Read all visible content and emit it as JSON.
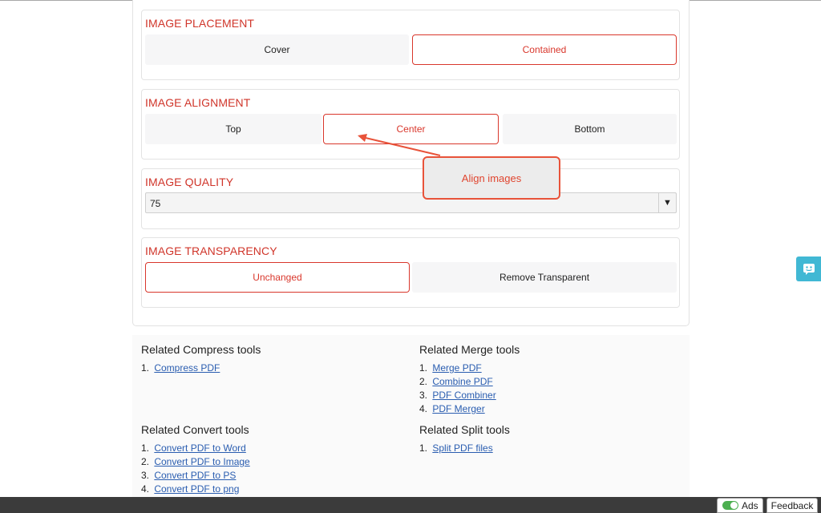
{
  "placement": {
    "title": "IMAGE PLACEMENT",
    "options": [
      "Cover",
      "Contained"
    ],
    "selected": "Contained"
  },
  "alignment": {
    "title": "IMAGE ALIGNMENT",
    "options": [
      "Top",
      "Center",
      "Bottom"
    ],
    "selected": "Center"
  },
  "quality": {
    "title": "IMAGE QUALITY",
    "value": "75",
    "arrow": "▼"
  },
  "transparency": {
    "title": "IMAGE TRANSPARENCY",
    "options": [
      "Unchanged",
      "Remove Transparent"
    ],
    "selected": "Unchanged"
  },
  "tooltip": {
    "text": "Align images",
    "color": "#e8533a"
  },
  "related": {
    "compress": {
      "title": "Related Compress tools",
      "items": [
        "Compress PDF"
      ]
    },
    "merge": {
      "title": "Related Merge tools",
      "items": [
        "Merge PDF",
        "Combine PDF",
        "PDF Combiner",
        "PDF Merger"
      ]
    },
    "convert": {
      "title": "Related Convert tools",
      "items": [
        "Convert PDF to Word",
        "Convert PDF to Image",
        "Convert PDF to PS",
        "Convert PDF to png"
      ]
    },
    "split": {
      "title": "Related Split tools",
      "items": [
        "Split PDF files"
      ]
    }
  },
  "footer": {
    "ads_label": "Ads",
    "feedback_label": "Feedback"
  },
  "colors": {
    "accent": "#d9372c",
    "link": "#2a5db0",
    "chat": "#41b8d4"
  },
  "icons": {
    "chat": "chat-icon",
    "select_arrow": "chevron-down-icon"
  }
}
